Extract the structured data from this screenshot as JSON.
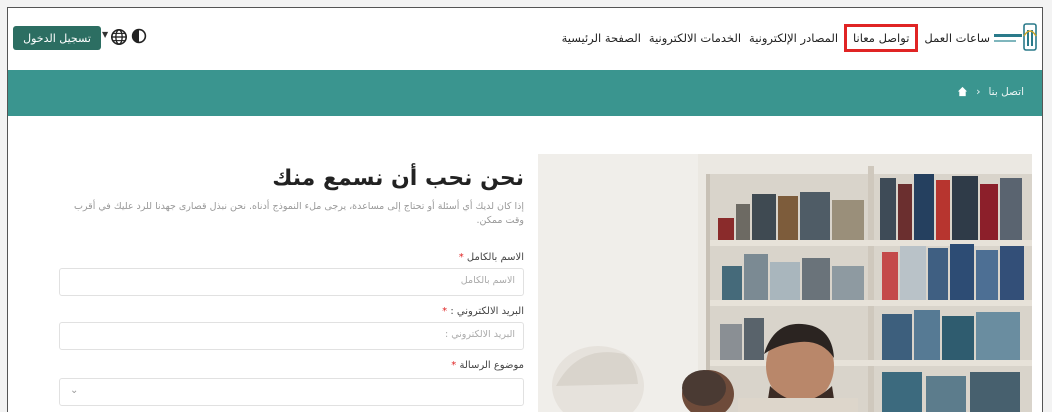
{
  "nav": {
    "login_label": "تسجيل الدخول",
    "items": [
      {
        "label": "الصفحة الرئيسية"
      },
      {
        "label": "الخدمات الالكترونية"
      },
      {
        "label": "المصادر الإلكترونية"
      },
      {
        "label": "تواصل معانا",
        "highlighted": true
      },
      {
        "label": "ساعات العمل"
      }
    ],
    "logo_name": "university-logo"
  },
  "breadcrumb": {
    "current": "اتصل بنا",
    "icon": "home-icon"
  },
  "contact": {
    "heading": "نحن نحب أن نسمع منك",
    "intro": "إذا كان لديك أي أسئلة أو تحتاج إلى مساعدة، يرجى ملء النموذج أدناه. نحن نبذل قصارى جهدنا للرد عليك في أقرب وقت ممكن.",
    "fields": {
      "name_label": "الاسم بالكامل",
      "name_placeholder": "الاسم بالكامل",
      "email_label": "البريد الالكتروني :",
      "email_placeholder": "البريد الالكتروني :",
      "subject_label": "موضوع الرسالة",
      "required_mark": "*"
    }
  },
  "colors": {
    "teal": "#3a958f",
    "button": "#2c6e62",
    "highlight": "#e02424"
  }
}
